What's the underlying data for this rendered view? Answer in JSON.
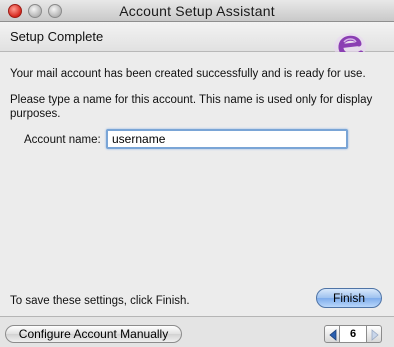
{
  "window": {
    "title": "Account Setup Assistant"
  },
  "header": {
    "page_title": "Setup Complete",
    "logo_icon": "entourage-e-logo"
  },
  "content": {
    "success_text": "Your mail account has been created successfully and is ready for use.",
    "instruction_text": "Please type a name for this account. This name is used only for display purposes.",
    "account_name_label": "Account name:",
    "account_name_value": "username",
    "finish_hint": "To save these settings, click Finish."
  },
  "buttons": {
    "finish_label": "Finish",
    "configure_manually_label": "Configure Account Manually"
  },
  "pager": {
    "page_number": "6",
    "prev_icon": "triangle-left-icon",
    "next_icon": "triangle-right-icon"
  },
  "colors": {
    "accent": "#7aa5d6",
    "finish_button": "#9ec2ef",
    "logo_purple": "#8b3fb3"
  }
}
